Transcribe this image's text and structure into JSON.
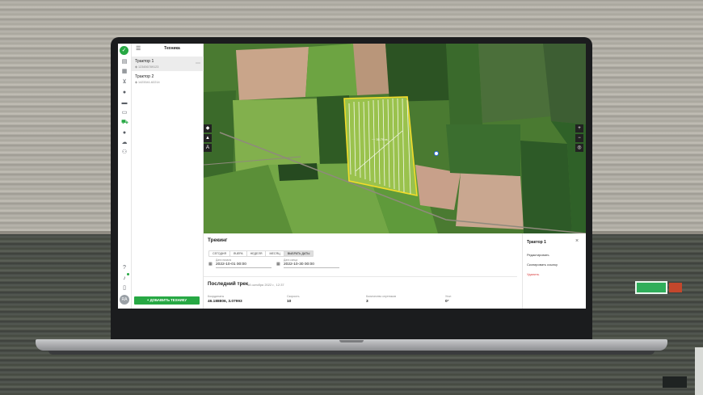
{
  "colors": {
    "accent": "#27a844",
    "danger": "#d83a3a",
    "field_boundary": "#f2dc2a"
  },
  "sidebar": {
    "title": "Техника",
    "items": [
      {
        "name": "Трактор 1",
        "sub": "◈ 123456789123",
        "selected": true
      },
      {
        "name": "Трактор 2",
        "sub": "◈ 1423341‑62214",
        "selected": false
      }
    ],
    "add_button": "+ ДОБАВИТЬ ТЕХНИКУ",
    "avatar": "RA"
  },
  "rail_icons": [
    "building-icon",
    "calendar-icon",
    "cart-icon",
    "globe-icon",
    "document-icon",
    "wallet-icon",
    "tractor-icon",
    "person-icon",
    "cloud-icon",
    "team-icon",
    "help-icon",
    "bell-icon",
    "phone-icon"
  ],
  "map": {
    "area_label": "~~ 35.79 га",
    "controls": {
      "layers": "layers-icon",
      "shapes": "shapes-icon",
      "text": "A",
      "zoom_in": "+",
      "zoom_out": "−",
      "locate": "locate-icon"
    }
  },
  "tracking": {
    "title": "Трекинг",
    "ranges": [
      "СЕГОДНЯ",
      "ВЧЕРА",
      "НЕДЕЛЯ",
      "МЕСЯЦ",
      "ВЫБРАТЬ ДАТЫ"
    ],
    "active_range": "ВЫБРАТЬ ДАТЫ",
    "date_from": {
      "label": "Дата начала",
      "value": "2022-10-01 00:00"
    },
    "date_to": {
      "label": "Дата конца",
      "value": "2022-10-30 00:00"
    },
    "last_track_title": "Последний трек",
    "last_track_date": "18 октября 2022 г., 12:37",
    "stats": [
      {
        "label": "Координаты",
        "value": "46.188806, 3.07993"
      },
      {
        "label": "Скорость",
        "value": "10"
      },
      {
        "label": "Количество спутников",
        "value": "3"
      },
      {
        "label": "Угол",
        "value": "0°"
      }
    ]
  },
  "context_menu": {
    "title": "Трактор 1",
    "items": [
      "Редактировать",
      "Скопировать ссылку",
      "Удалить"
    ]
  }
}
